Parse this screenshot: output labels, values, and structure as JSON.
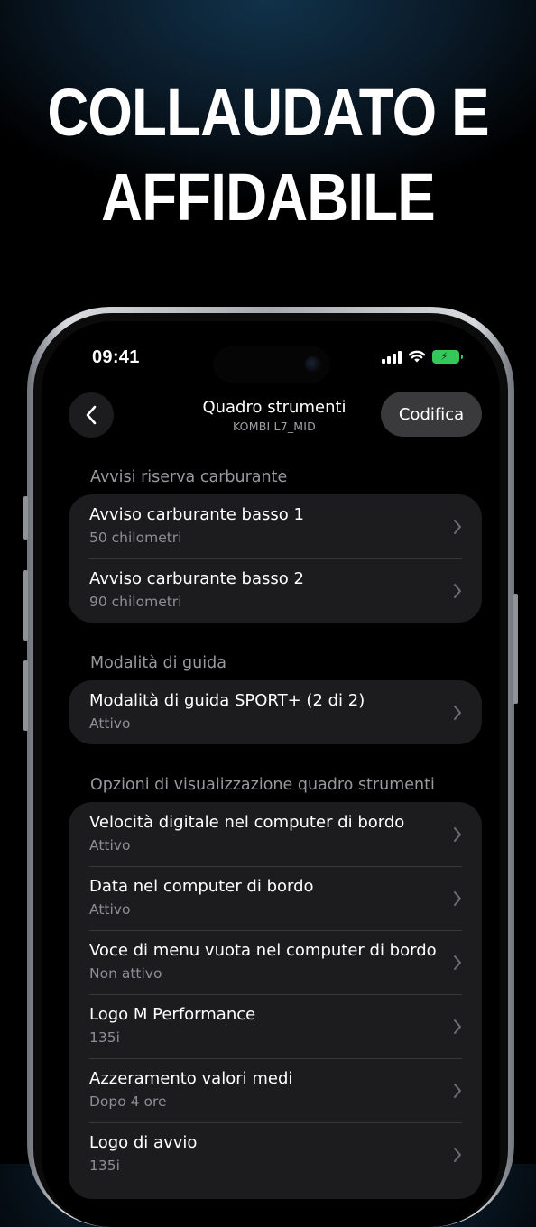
{
  "headline": {
    "line1": "COLLAUDATO E",
    "line2": "AFFIDABILE"
  },
  "status_bar": {
    "time": "09:41"
  },
  "nav": {
    "title": "Quadro strumenti",
    "subtitle": "KOMBI L7_MID",
    "edit_label": "Codifica"
  },
  "sections": [
    {
      "header": "Avvisi riserva carburante",
      "rows": [
        {
          "title": "Avviso carburante basso 1",
          "value": "50 chilometri"
        },
        {
          "title": "Avviso carburante basso 2",
          "value": "90 chilometri"
        }
      ]
    },
    {
      "header": "Modalità di guida",
      "rows": [
        {
          "title": "Modalità di guida SPORT+ (2 di 2)",
          "value": "Attivo"
        }
      ]
    },
    {
      "header": "Opzioni di visualizzazione quadro strumenti",
      "rows": [
        {
          "title": "Velocità digitale nel computer di bordo",
          "value": "Attivo"
        },
        {
          "title": "Data nel computer di bordo",
          "value": "Attivo"
        },
        {
          "title": "Voce di menu vuota nel computer di bordo",
          "value": "Non attivo"
        },
        {
          "title": "Logo M Performance",
          "value": "135i"
        },
        {
          "title": "Azzeramento valori medi",
          "value": "Dopo 4 ore"
        },
        {
          "title": "Logo di avvio",
          "value": "135i"
        }
      ]
    }
  ],
  "colors": {
    "background": "#000000",
    "card": "#1c1c1e",
    "accent_battery": "#34c759"
  },
  "icons": [
    "back-chevron-icon",
    "chevron-right-icon",
    "signal-icon",
    "wifi-icon",
    "battery-charging-icon"
  ]
}
